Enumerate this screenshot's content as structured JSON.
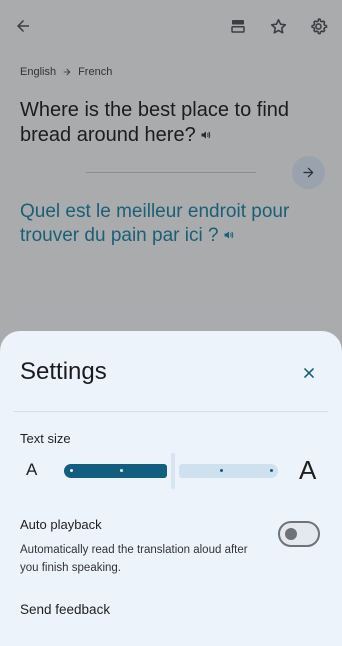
{
  "app_bar": {
    "back_icon": "arrow-left-icon",
    "icons": [
      "saved-list-icon",
      "star-icon",
      "gear-icon"
    ]
  },
  "languages": {
    "source": "English",
    "target": "French"
  },
  "translation": {
    "source_text": "Where is the best place to find bread around here?",
    "target_text": "Quel est le meilleur endroit pour trouver du pain par ici ?",
    "target_color": "#1b5f77"
  },
  "settings": {
    "title": "Settings",
    "text_size": {
      "label": "Text size",
      "small_glyph": "A",
      "large_glyph": "A",
      "steps": 5,
      "selected_step": 3
    },
    "auto_playback": {
      "label": "Auto playback",
      "description": "Automatically read the translation aloud after you finish speaking.",
      "enabled": false
    },
    "send_feedback": "Send feedback",
    "accent_color": "#125e7e"
  }
}
